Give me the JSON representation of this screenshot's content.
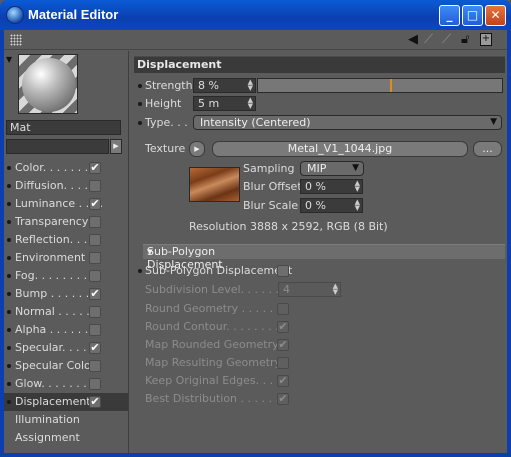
{
  "window": {
    "title": "Material Editor"
  },
  "material": {
    "name": "Mat"
  },
  "channels": [
    {
      "label": "Color. . . . . . . .",
      "checked": true
    },
    {
      "label": "Diffusion. . . . .",
      "checked": false
    },
    {
      "label": "Luminance . . . .",
      "checked": true
    },
    {
      "label": "Transparency",
      "checked": false
    },
    {
      "label": "Reflection. . . .",
      "checked": false
    },
    {
      "label": "Environment",
      "checked": false
    },
    {
      "label": "Fog. . . . . . . . .",
      "checked": false
    },
    {
      "label": "Bump . . . . . . .",
      "checked": true
    },
    {
      "label": "Normal . . . . . .",
      "checked": false
    },
    {
      "label": "Alpha . . . . . . .",
      "checked": false
    },
    {
      "label": "Specular. . . . . .",
      "checked": true
    },
    {
      "label": "Specular Color",
      "checked": false
    },
    {
      "label": "Glow. . . . . . . .",
      "checked": false
    },
    {
      "label": "Displacement",
      "checked": true,
      "active": true
    }
  ],
  "extra_items": [
    "Illumination",
    "Assignment"
  ],
  "displacement": {
    "header": "Displacement",
    "strength_label": "Strength",
    "strength_value": "8 %",
    "strength_fraction": 0.08,
    "height_label": "Height",
    "height_value": "5 m",
    "type_label": "Type. . .",
    "type_value": "Intensity (Centered)",
    "texture_label": "Texture",
    "texture_file": "Metal_V1_1044.jpg",
    "browse_label": "...",
    "sampling_label": "Sampling",
    "sampling_value": "MIP",
    "blur_offset_label": "Blur Offset",
    "blur_offset_value": "0 %",
    "blur_scale_label": "Blur Scale",
    "blur_scale_value": "0 %",
    "resolution": "Resolution 3888 x 2592, RGB (8 Bit)"
  },
  "subpolygon": {
    "header": "Sub-Polygon Displacement",
    "toggle_label": "Sub-Polygon Displacement",
    "subdivision_label": "Subdivision Level. . . . . . .",
    "subdivision_value": "4",
    "options": [
      {
        "label": "Round Geometry . . . . . .",
        "checked": false
      },
      {
        "label": "Round Contour. . . . . . . .",
        "checked": true
      },
      {
        "label": "Map Rounded Geometry .",
        "checked": true
      },
      {
        "label": "Map Resulting Geometry .",
        "checked": false
      },
      {
        "label": "Keep Original Edges. . . .",
        "checked": true
      },
      {
        "label": "Best Distribution . . . . . .",
        "checked": true
      }
    ]
  },
  "colors": {
    "titlebar": "#0b47c0",
    "panel": "#5b5b5b",
    "accent": "#e08c1a"
  },
  "icons": {
    "app": "cinema4d-logo-icon",
    "check": "✔"
  }
}
